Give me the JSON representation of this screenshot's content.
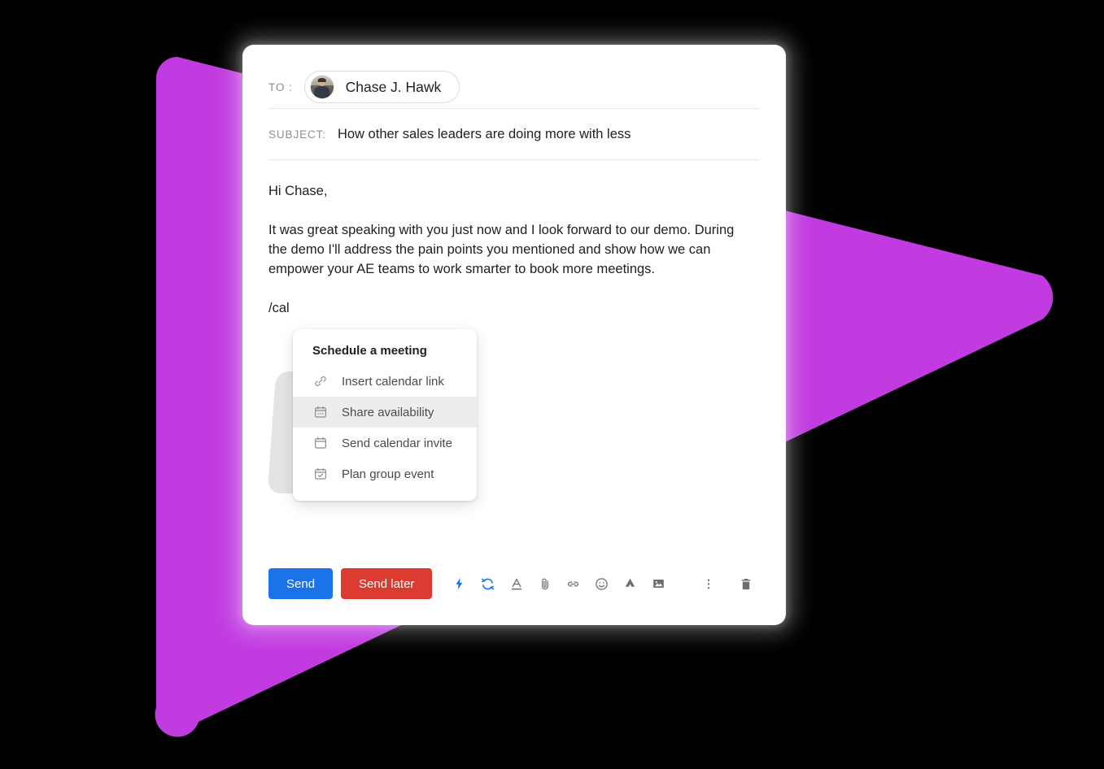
{
  "background": {
    "canvas_color": "#000000",
    "accent_shape_color": "#C13BE0"
  },
  "compose": {
    "to_label": "TO :",
    "recipient_name": "Chase J. Hawk",
    "avatar_alt": "avatar",
    "subject_label": "SUBJECT:",
    "subject_value": "How other sales leaders are doing more with less",
    "body": {
      "greeting": "Hi Chase,",
      "paragraph": "It was great speaking with you just now and I look forward to our demo. During the demo I'll address the pain points you mentioned and show how we can empower your AE teams to work smarter to book more meetings.",
      "slash_command": "/cal"
    }
  },
  "slash_menu": {
    "title": "Schedule a meeting",
    "items": [
      {
        "label": "Insert calendar link",
        "icon": "link-icon",
        "selected": false
      },
      {
        "label": "Share availability",
        "icon": "calendar-dots-icon",
        "selected": true
      },
      {
        "label": "Send calendar invite",
        "icon": "calendar-icon",
        "selected": false
      },
      {
        "label": "Plan group event",
        "icon": "calendar-check-icon",
        "selected": false
      }
    ]
  },
  "toolbar": {
    "send_label": "Send",
    "send_later_label": "Send later",
    "send_color": "#1A73E8",
    "send_later_color": "#DB3B30",
    "icons": [
      {
        "name": "lightning-bolt-icon",
        "color": "#1A73E8"
      },
      {
        "name": "sync-loop-icon",
        "color": "#1A73E8"
      },
      {
        "name": "text-format-icon",
        "color": "#6E6E6E"
      },
      {
        "name": "attachment-icon",
        "color": "#6E6E6E"
      },
      {
        "name": "link-icon",
        "color": "#6E6E6E"
      },
      {
        "name": "emoji-icon",
        "color": "#6E6E6E"
      },
      {
        "name": "google-drive-icon",
        "color": "#6E6E6E"
      },
      {
        "name": "insert-image-icon",
        "color": "#6E6E6E"
      }
    ],
    "right_icons": [
      {
        "name": "more-options-icon",
        "color": "#6E6E6E"
      },
      {
        "name": "delete-draft-icon",
        "color": "#6E6E6E"
      }
    ]
  }
}
